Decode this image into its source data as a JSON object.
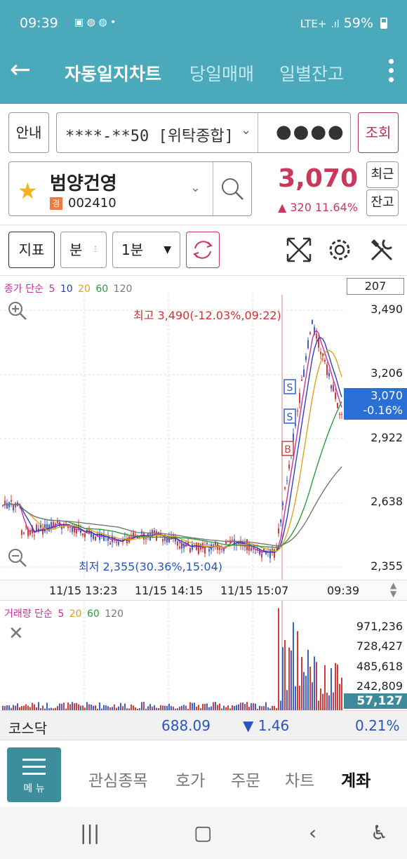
{
  "status": {
    "time": "09:39",
    "network": "LTE+",
    "battery": "59%"
  },
  "header": {
    "tabs": [
      "자동일지차트",
      "당일매매",
      "일별잔고"
    ]
  },
  "account": {
    "guide_label": "안내",
    "number": "****-**50 [위탁종합]",
    "password_mask": "●●●●",
    "query_label": "조회"
  },
  "stock": {
    "name": "범양건영",
    "badge": "경",
    "code": "002410",
    "price": "3,070",
    "change": "▲ 320   11.64%",
    "recent_label": "최근",
    "balance_label": "잔고"
  },
  "toolbar": {
    "indicator_label": "지표",
    "period_label": "분",
    "interval_value": "1분"
  },
  "chart": {
    "legend_price": [
      "종가 단순",
      "5",
      "10",
      "20",
      "60",
      "120"
    ],
    "legend_volume": [
      "거래량 단순",
      "5",
      "20",
      "60",
      "120"
    ],
    "count_box": "207",
    "y_ticks": [
      "3,490",
      "3,206",
      "2,922",
      "2,638",
      "2,355"
    ],
    "current_price": "3,070",
    "current_change": "-0.16%",
    "high_annotation": "최고 3,490(-12.03%,09:22)",
    "low_annotation": "최저 2,355(30.36%,15:04)",
    "x_ticks": [
      "11/15 13:23",
      "11/15 14:15",
      "11/15 15:07",
      "09:39"
    ],
    "vol_ticks": [
      "971,236",
      "728,427",
      "485,618",
      "242,809"
    ],
    "current_volume": "57,127",
    "signal_labels": {
      "sell": "S",
      "buy": "B"
    },
    "colors": {
      "ma5": "#c6329f",
      "ma10": "#2d3fbf",
      "ma20": "#e2a21a",
      "ma60": "#2e9b3d",
      "ma120": "#777777",
      "up": "#d43b3b",
      "down": "#3a5fd0"
    }
  },
  "index": {
    "name": "코스닥",
    "value": "688.09",
    "change": "▼ 1.46",
    "rate": "0.21%"
  },
  "bottom_nav": {
    "menu_label": "메 뉴",
    "items": [
      "관심종목",
      "호가",
      "주문",
      "차트",
      "계좌"
    ]
  }
}
